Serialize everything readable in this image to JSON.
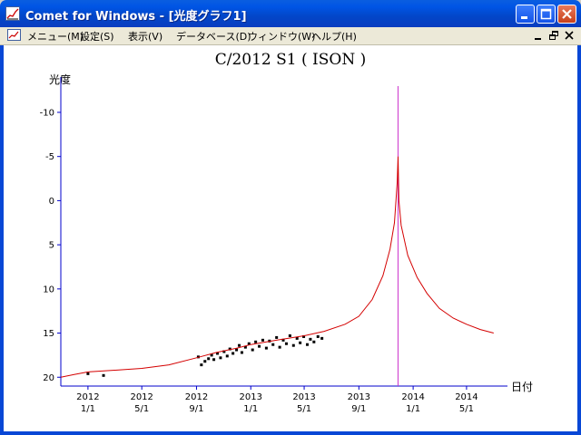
{
  "window": {
    "title": "Comet for Windows - [光度グラフ1]",
    "icon": "app-graph-icon",
    "controls": [
      "minimize-icon",
      "maximize-icon",
      "close-icon"
    ]
  },
  "menubar": {
    "items": [
      "メニュー(M)",
      "設定(S)",
      "表示(V)",
      "データベース(D)",
      "ウィンドウ(W)",
      "ヘルプ(H)"
    ],
    "mdi_controls": [
      "mdi-minimize-icon",
      "mdi-restore-icon",
      "mdi-close-icon"
    ]
  },
  "chart_data": {
    "type": "scatter",
    "title": "C/2012 S1 ( ISON )",
    "ylabel": "光度",
    "xlabel": "日付",
    "y_inverted": true,
    "ylim": [
      21,
      -14
    ],
    "yticks": [
      -10,
      -5,
      0,
      5,
      10,
      15,
      20
    ],
    "xlim": [
      "2011-11-01",
      "2014-08-01"
    ],
    "xticks": [
      {
        "date": "2012-01-01",
        "year": "2012",
        "md": "1/1"
      },
      {
        "date": "2012-05-01",
        "year": "2012",
        "md": "5/1"
      },
      {
        "date": "2012-09-01",
        "year": "2012",
        "md": "9/1"
      },
      {
        "date": "2013-01-01",
        "year": "2013",
        "md": "1/1"
      },
      {
        "date": "2013-05-01",
        "year": "2013",
        "md": "5/1"
      },
      {
        "date": "2013-09-01",
        "year": "2013",
        "md": "9/1"
      },
      {
        "date": "2014-01-01",
        "year": "2014",
        "md": "1/1"
      },
      {
        "date": "2014-05-01",
        "year": "2014",
        "md": "5/1"
      }
    ],
    "perihelion_line": {
      "date": "2013-11-28",
      "color": "#cc33cc"
    },
    "curve": {
      "color": "#d40000",
      "points": [
        [
          "2011-11-01",
          20.0
        ],
        [
          "2011-12-01",
          19.7
        ],
        [
          "2012-01-01",
          19.4
        ],
        [
          "2012-03-01",
          19.2
        ],
        [
          "2012-05-01",
          19.0
        ],
        [
          "2012-07-01",
          18.6
        ],
        [
          "2012-09-01",
          17.8
        ],
        [
          "2012-10-15",
          17.2
        ],
        [
          "2012-12-01",
          16.7
        ],
        [
          "2013-01-01",
          16.3
        ],
        [
          "2013-03-01",
          15.8
        ],
        [
          "2013-05-01",
          15.3
        ],
        [
          "2013-06-15",
          14.8
        ],
        [
          "2013-08-01",
          14.0
        ],
        [
          "2013-09-01",
          13.1
        ],
        [
          "2013-10-01",
          11.2
        ],
        [
          "2013-10-25",
          8.5
        ],
        [
          "2013-11-10",
          5.5
        ],
        [
          "2013-11-20",
          2.5
        ],
        [
          "2013-11-26",
          -2.0
        ],
        [
          "2013-11-28",
          -5.0
        ],
        [
          "2013-11-30",
          0.0
        ],
        [
          "2013-12-05",
          2.8
        ],
        [
          "2013-12-20",
          6.2
        ],
        [
          "2014-01-10",
          8.7
        ],
        [
          "2014-02-01",
          10.5
        ],
        [
          "2014-03-01",
          12.2
        ],
        [
          "2014-04-01",
          13.3
        ],
        [
          "2014-05-01",
          14.0
        ],
        [
          "2014-06-01",
          14.6
        ],
        [
          "2014-07-01",
          15.0
        ]
      ]
    },
    "observations": [
      [
        "2012-01-01",
        19.6
      ],
      [
        "2012-02-05",
        19.8
      ],
      [
        "2012-09-05",
        17.7
      ],
      [
        "2012-09-12",
        18.6
      ],
      [
        "2012-09-20",
        18.2
      ],
      [
        "2012-09-28",
        17.9
      ],
      [
        "2012-10-05",
        17.5
      ],
      [
        "2012-10-10",
        18.0
      ],
      [
        "2012-10-18",
        17.3
      ],
      [
        "2012-10-25",
        17.8
      ],
      [
        "2012-11-02",
        17.1
      ],
      [
        "2012-11-09",
        17.6
      ],
      [
        "2012-11-15",
        16.8
      ],
      [
        "2012-11-22",
        17.3
      ],
      [
        "2012-11-30",
        16.9
      ],
      [
        "2012-12-06",
        16.4
      ],
      [
        "2012-12-12",
        17.2
      ],
      [
        "2012-12-20",
        16.6
      ],
      [
        "2012-12-28",
        16.2
      ],
      [
        "2013-01-05",
        16.9
      ],
      [
        "2013-01-12",
        16.0
      ],
      [
        "2013-01-20",
        16.5
      ],
      [
        "2013-01-28",
        15.8
      ],
      [
        "2013-02-05",
        16.7
      ],
      [
        "2013-02-12",
        15.9
      ],
      [
        "2013-02-20",
        16.3
      ],
      [
        "2013-02-28",
        15.5
      ],
      [
        "2013-03-07",
        16.6
      ],
      [
        "2013-03-15",
        15.8
      ],
      [
        "2013-03-22",
        16.2
      ],
      [
        "2013-03-30",
        15.3
      ],
      [
        "2013-04-07",
        16.4
      ],
      [
        "2013-04-15",
        15.6
      ],
      [
        "2013-04-22",
        16.1
      ],
      [
        "2013-04-30",
        15.4
      ],
      [
        "2013-05-08",
        16.3
      ],
      [
        "2013-05-15",
        15.7
      ],
      [
        "2013-05-23",
        16.0
      ],
      [
        "2013-06-01",
        15.4
      ],
      [
        "2013-06-10",
        15.6
      ]
    ]
  }
}
